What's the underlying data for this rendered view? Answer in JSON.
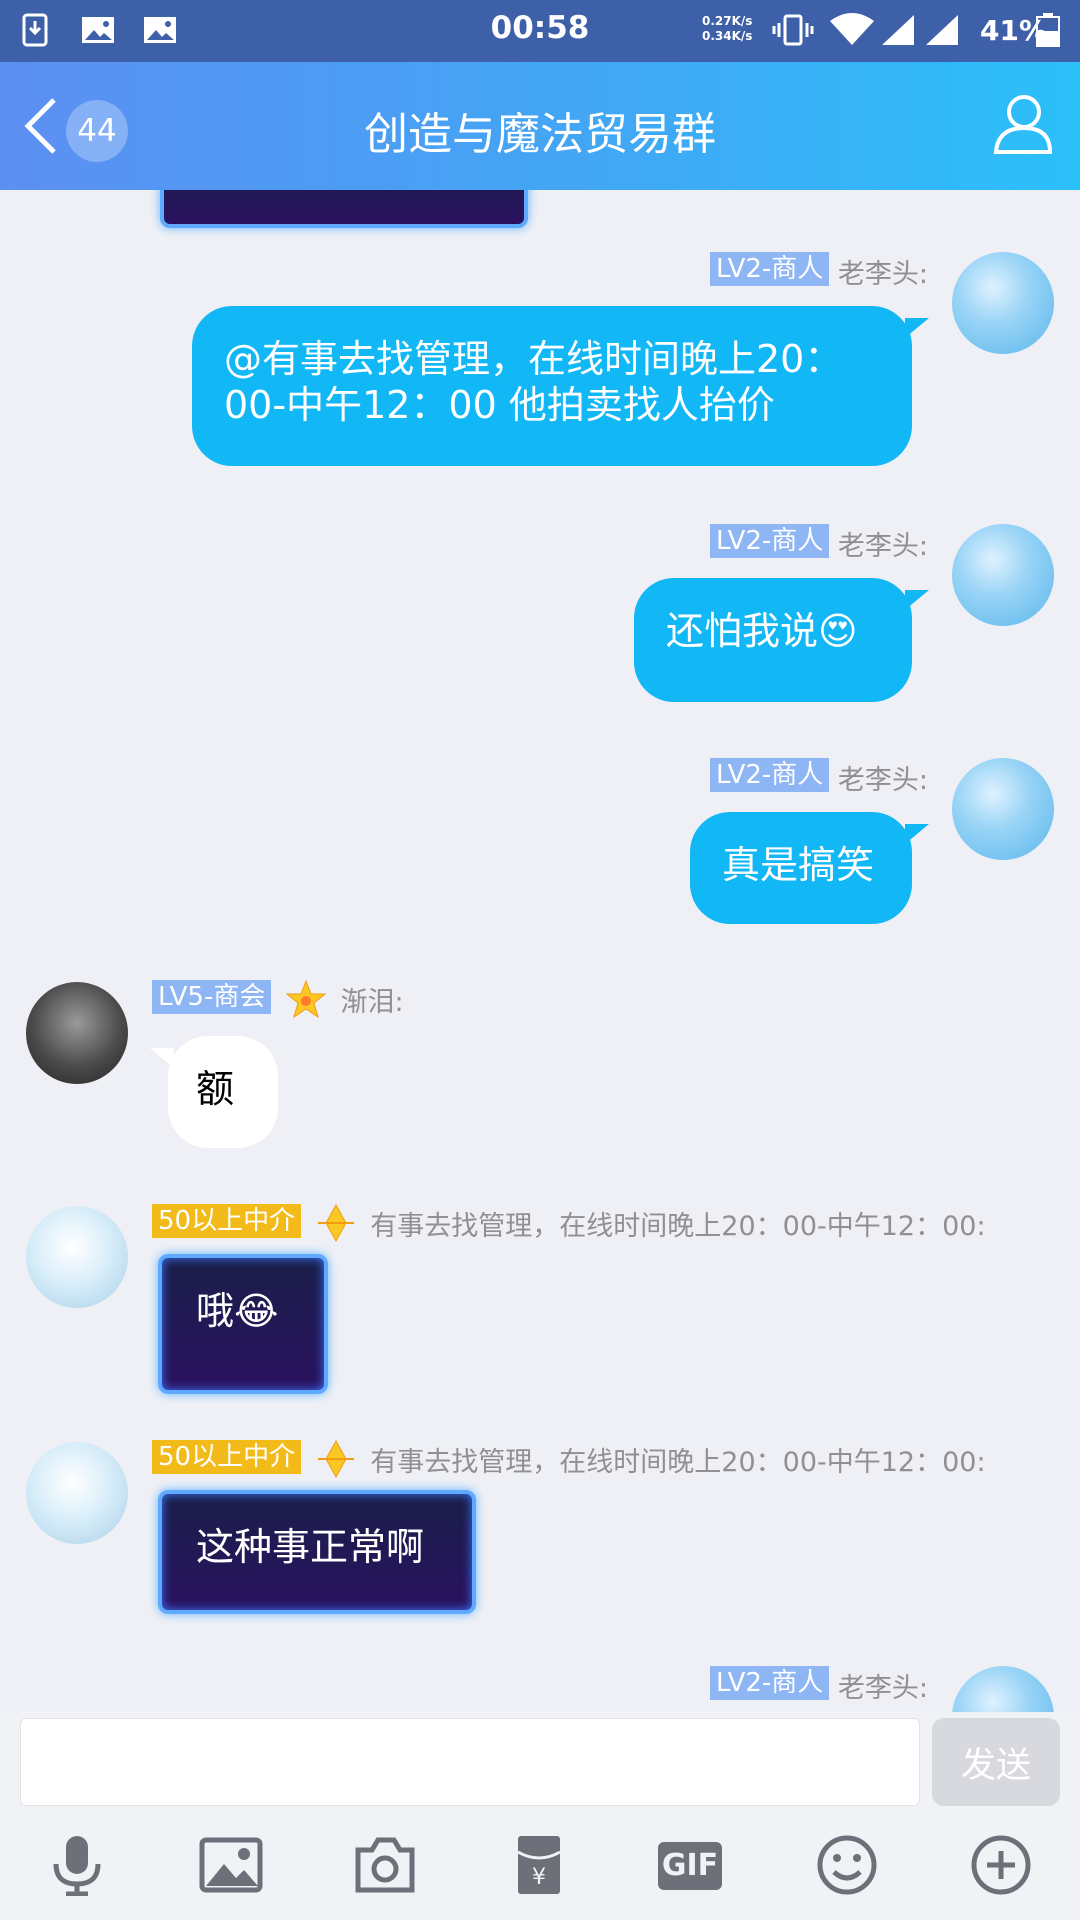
{
  "status_bar": {
    "time": "00:58",
    "net_up": "0.27K/s",
    "net_down": "0.34K/s",
    "battery": "41%"
  },
  "header": {
    "back_count": "44",
    "title": "创造与魔法贸易群"
  },
  "messages": [
    {
      "side": "right",
      "tag": "LV2-商人",
      "sender": "老李头:",
      "text_line1": "@有事去找管理，在线时间晚上20：",
      "text_line2": "00-中午12：00 他拍卖找人抬价"
    },
    {
      "side": "right",
      "tag": "LV2-商人",
      "sender": "老李头:",
      "text": "还怕我说😍"
    },
    {
      "side": "right",
      "tag": "LV2-商人",
      "sender": "老李头:",
      "text": "真是搞笑"
    },
    {
      "side": "left",
      "tag": "LV5-商会",
      "sender": "渐泪:",
      "text": "额"
    },
    {
      "side": "left",
      "tag": "50以上中介",
      "sender": "有事去找管理，在线时间晚上20：00-中午12：00:",
      "text": "哦😂"
    },
    {
      "side": "left",
      "tag": "50以上中介",
      "sender": "有事去找管理，在线时间晚上20：00-中午12：00:",
      "text": "这种事正常啊"
    },
    {
      "side": "right",
      "tag": "LV2-商人",
      "sender": "老李头:"
    }
  ],
  "input": {
    "value": "",
    "send_label": "发送"
  },
  "toolbar": {
    "gif_label": "GIF",
    "icons": [
      "microphone-icon",
      "image-icon",
      "camera-icon",
      "red-packet-icon",
      "gif-icon",
      "emoji-icon",
      "plus-icon"
    ]
  },
  "colors": {
    "bubble_self": "#12b7f5",
    "header_start": "#5c8ff2",
    "header_end": "#2bc0f8",
    "tag_blue": "#8eb5f4",
    "tag_gold": "#f3bb1a"
  }
}
